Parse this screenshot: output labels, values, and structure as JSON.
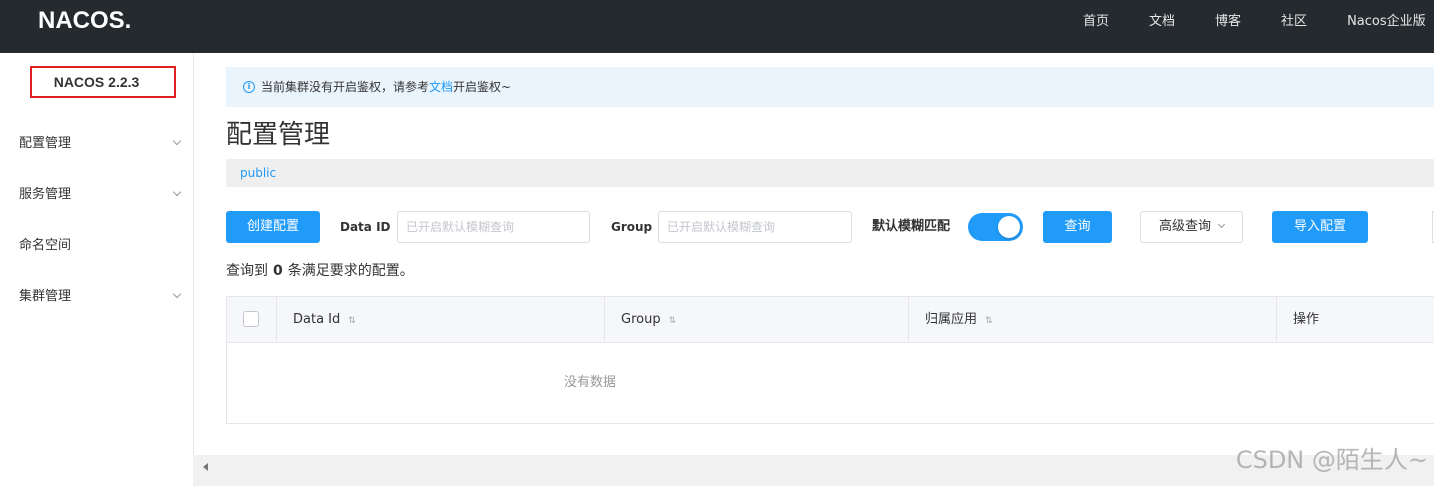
{
  "header": {
    "logo_text": "NACOS.",
    "nav": [
      {
        "label": "首页"
      },
      {
        "label": "文档"
      },
      {
        "label": "博客"
      },
      {
        "label": "社区"
      },
      {
        "label": "Nacos企业版"
      }
    ]
  },
  "sidebar": {
    "version": "NACOS 2.2.3",
    "items": [
      {
        "label": "配置管理",
        "expandable": true
      },
      {
        "label": "服务管理",
        "expandable": true
      },
      {
        "label": "命名空间",
        "expandable": false
      },
      {
        "label": "集群管理",
        "expandable": true
      }
    ]
  },
  "notice": {
    "icon": "info-icon",
    "text_before": "当前集群没有开启鉴权，请参考",
    "link_text": "文档",
    "text_after": "开启鉴权~"
  },
  "page": {
    "title": "配置管理"
  },
  "namespace": {
    "current": "public"
  },
  "toolbar": {
    "create_button": "创建配置",
    "data_id_label": "Data ID",
    "data_id_value": "",
    "data_id_placeholder": "已开启默认模糊查询",
    "group_label": "Group",
    "group_value": "",
    "group_placeholder": "已开启默认模糊查询",
    "fuzzy_match_label": "默认模糊匹配",
    "fuzzy_match_on": true,
    "search_button": "查询",
    "advanced_search_button": "高级查询",
    "import_button": "导入配置"
  },
  "result_summary": {
    "prefix": "查询到",
    "count": "0",
    "suffix": "条满足要求的配置。"
  },
  "table": {
    "select_all_checked": false,
    "columns": [
      {
        "label": "Data Id",
        "sortable": true
      },
      {
        "label": "Group",
        "sortable": true
      },
      {
        "label": "归属应用",
        "sortable": true
      },
      {
        "label": "操作",
        "sortable": false
      }
    ],
    "rows": [],
    "empty_text": "没有数据"
  },
  "watermark": "CSDN @陌生人~",
  "colors": {
    "header_bg": "#252a2f",
    "primary": "#209bfa",
    "notice_bg": "#eaf4fd",
    "highlight_border": "#e02020"
  }
}
